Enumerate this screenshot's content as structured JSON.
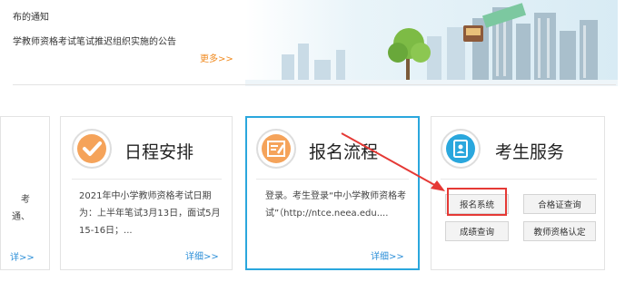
{
  "banner": {
    "news_items": [
      "布的通知",
      "学教师资格考试笔试推迟组织实施的公告"
    ],
    "more_link": "更多>>"
  },
  "left_card": {
    "lines": [
      "考",
      "通、"
    ],
    "detail": "详>>"
  },
  "schedule": {
    "title": "日程安排",
    "desc": "2021年中小学教师资格考试日期为：上半年笔试3月13日，面试5月15-16日；...",
    "detail": "详细>>",
    "icon": "check-icon"
  },
  "registration": {
    "title": "报名流程",
    "desc": "登录。考生登录“中小学教师资格考试”（http://ntce.neea.edu....",
    "detail": "详细>>",
    "icon": "form-icon"
  },
  "services": {
    "title": "考生服务",
    "icon": "contacts-icon",
    "buttons": [
      "报名系统",
      "合格证查询",
      "成绩查询",
      "教师资格认定"
    ]
  },
  "colors": {
    "accent_blue": "#2aa7dd",
    "highlight_red": "#e53935",
    "orange": "#f08a1f"
  }
}
